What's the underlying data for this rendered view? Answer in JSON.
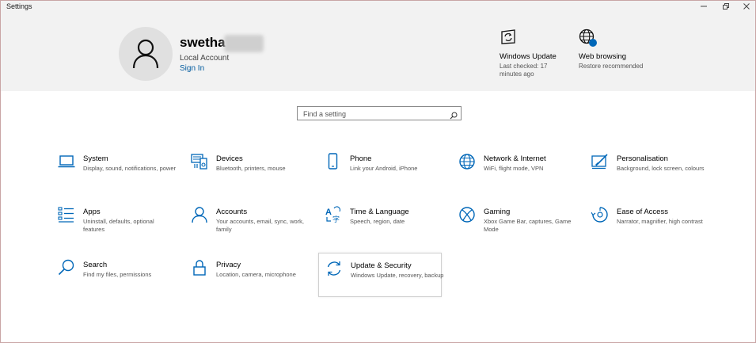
{
  "window": {
    "title": "Settings"
  },
  "header": {
    "user_name": "swetha",
    "account_type": "Local Account",
    "sign_in": "Sign In",
    "quick_links": [
      {
        "title": "Windows Update",
        "subtitle": "Last checked: 17 minutes ago",
        "icon": "windows-update-icon"
      },
      {
        "title": "Web browsing",
        "subtitle": "Restore recommended",
        "icon": "globe-icon"
      }
    ]
  },
  "search": {
    "placeholder": "Find a setting"
  },
  "tiles": [
    {
      "title": "System",
      "desc": "Display, sound, notifications, power",
      "icon": "laptop-icon"
    },
    {
      "title": "Devices",
      "desc": "Bluetooth, printers, mouse",
      "icon": "devices-icon"
    },
    {
      "title": "Phone",
      "desc": "Link your Android, iPhone",
      "icon": "phone-icon"
    },
    {
      "title": "Network & Internet",
      "desc": "WiFi, flight mode, VPN",
      "icon": "globe-icon"
    },
    {
      "title": "Personalisation",
      "desc": "Background, lock screen, colours",
      "icon": "paint-brush-icon"
    },
    {
      "title": "Apps",
      "desc": "Uninstall, defaults, optional features",
      "icon": "apps-list-icon"
    },
    {
      "title": "Accounts",
      "desc": "Your accounts, email, sync, work, family",
      "icon": "person-icon"
    },
    {
      "title": "Time & Language",
      "desc": "Speech, region, date",
      "icon": "time-language-icon"
    },
    {
      "title": "Gaming",
      "desc": "Xbox Game Bar, captures, Game Mode",
      "icon": "xbox-icon"
    },
    {
      "title": "Ease of Access",
      "desc": "Narrator, magnifier, high contrast",
      "icon": "ease-of-access-icon"
    },
    {
      "title": "Search",
      "desc": "Find my files, permissions",
      "icon": "search-icon"
    },
    {
      "title": "Privacy",
      "desc": "Location, camera, microphone",
      "icon": "lock-icon"
    },
    {
      "title": "Update & Security",
      "desc": "Windows Update, recovery, backup",
      "icon": "sync-icon"
    }
  ],
  "colors": {
    "accent": "#0067b8",
    "header_bg": "#f2f2f2",
    "link": "#005a9e"
  }
}
